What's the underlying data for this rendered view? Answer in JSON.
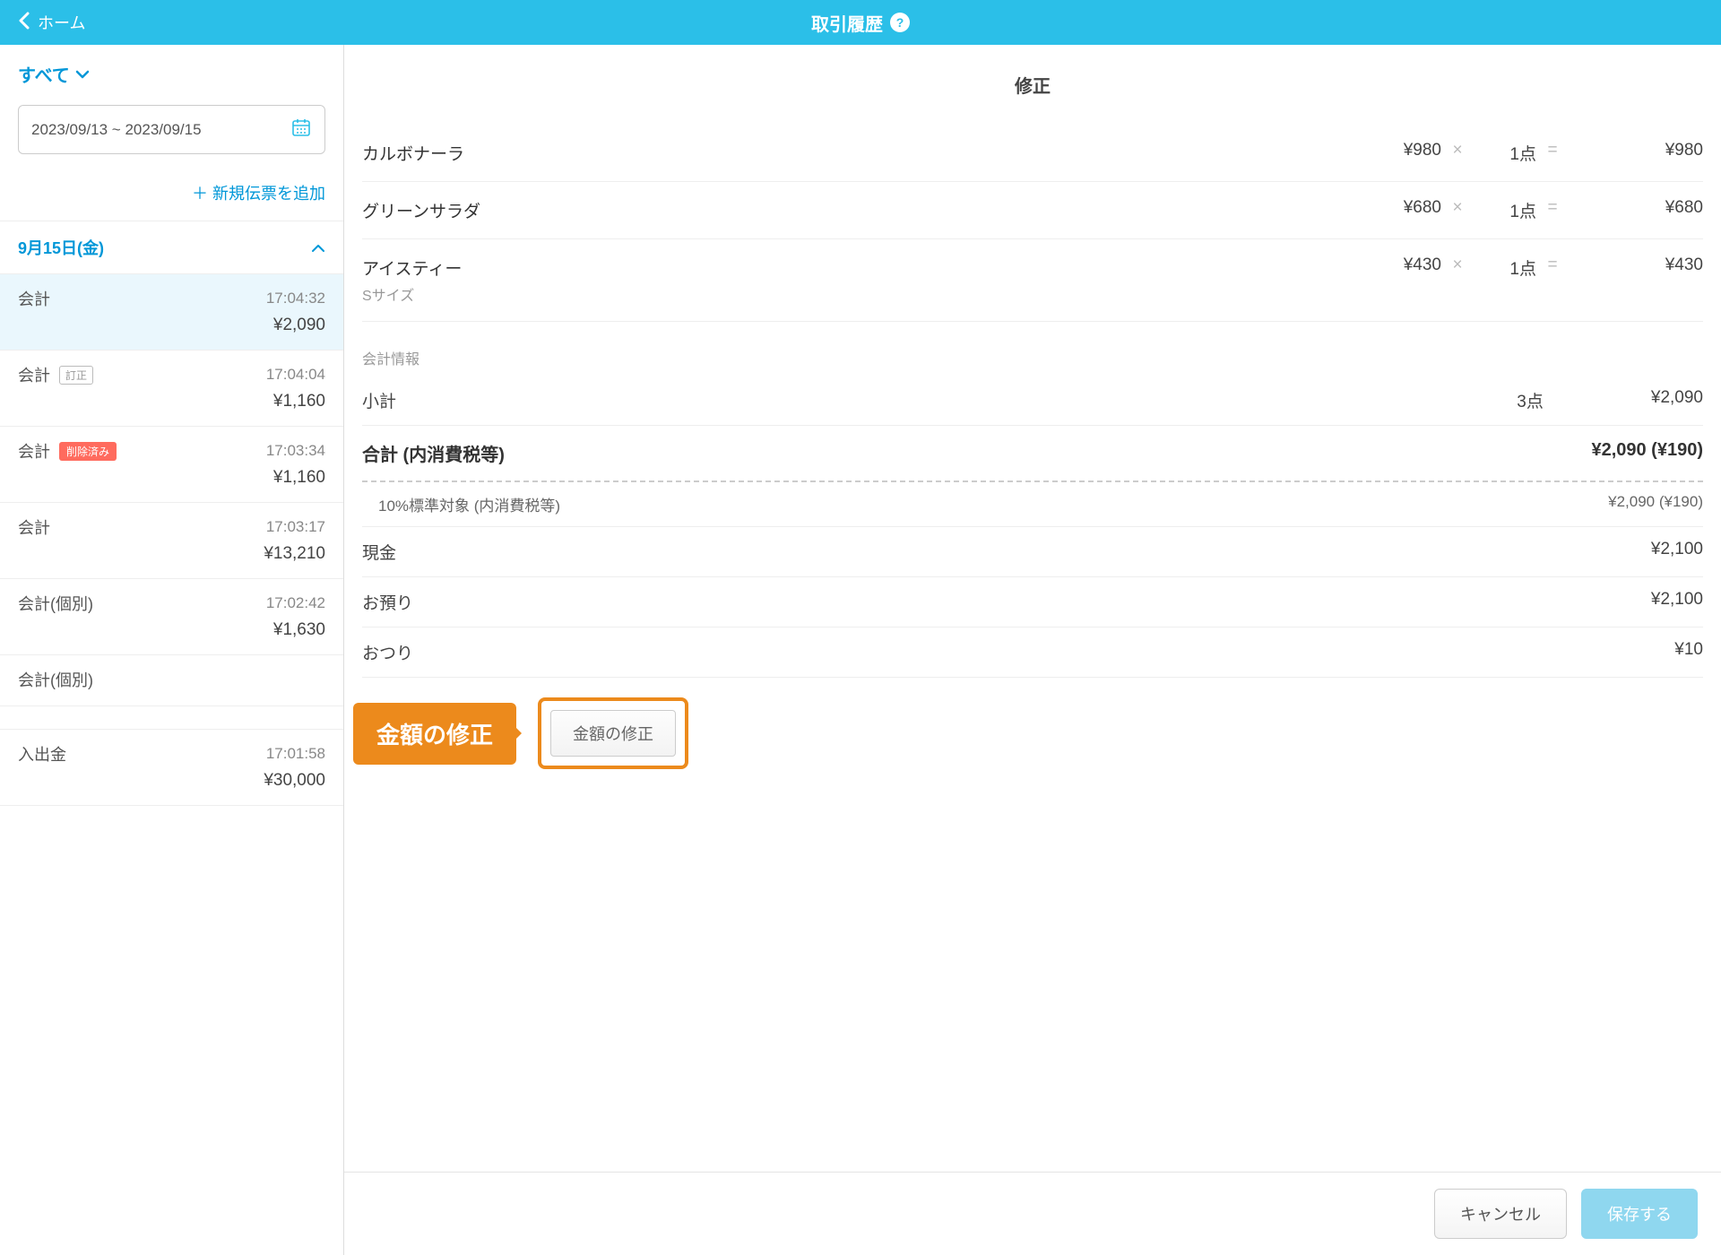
{
  "header": {
    "back_label": "ホーム",
    "title": "取引履歴"
  },
  "sidebar": {
    "filter_label": "すべて",
    "date_range": "2023/09/13 ~ 2023/09/15",
    "add_slip_label": "新規伝票を追加",
    "day_label": "9月15日(金)",
    "items": [
      {
        "label": "会計",
        "badge": "",
        "time": "17:04:32",
        "amount": "¥2,090",
        "selected": true
      },
      {
        "label": "会計",
        "badge": "訂正",
        "time": "17:04:04",
        "amount": "¥1,160"
      },
      {
        "label": "会計",
        "badge_deleted": "削除済み",
        "time": "17:03:34",
        "amount": "¥1,160"
      },
      {
        "label": "会計",
        "time": "17:03:17",
        "amount": "¥13,210"
      },
      {
        "label": "会計(個別)",
        "time": "17:02:42",
        "amount": "¥1,630"
      },
      {
        "label": "会計(個別)",
        "time": "",
        "amount": ""
      },
      {
        "label": "入出金",
        "time": "17:01:58",
        "amount": "¥30,000"
      }
    ]
  },
  "detail": {
    "title": "修正",
    "lines": [
      {
        "name": "カルボナーラ",
        "variant": "",
        "price": "¥980",
        "qty": "1点",
        "total": "¥980"
      },
      {
        "name": "グリーンサラダ",
        "variant": "",
        "price": "¥680",
        "qty": "1点",
        "total": "¥680"
      },
      {
        "name": "アイスティー",
        "variant": "Sサイズ",
        "price": "¥430",
        "qty": "1点",
        "total": "¥430"
      }
    ],
    "section_label": "会計情報",
    "subtotal_label": "小計",
    "subtotal_qty": "3点",
    "subtotal_amount": "¥2,090",
    "total_label": "合計 (内消費税等)",
    "total_amount": "¥2,090 (¥190)",
    "tax_label": "10%標準対象 (内消費税等)",
    "tax_amount": "¥2,090 (¥190)",
    "cash_label": "現金",
    "cash_amount": "¥2,100",
    "tendered_label": "お預り",
    "tendered_amount": "¥2,100",
    "change_label": "おつり",
    "change_amount": "¥10",
    "callout_text": "金額の修正",
    "edit_amount_button": "金額の修正"
  },
  "footer": {
    "cancel": "キャンセル",
    "save": "保存する"
  }
}
